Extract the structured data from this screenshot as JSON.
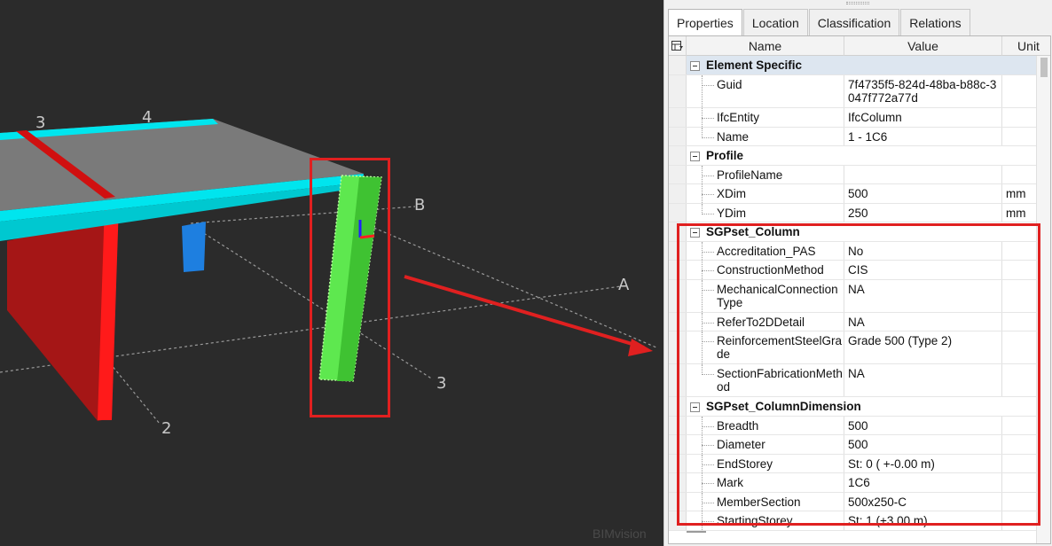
{
  "viewport": {
    "grid_labels": {
      "a": "A",
      "b": "B",
      "n2": "2",
      "n3_top": "3",
      "n3_bottom": "3",
      "n4": "4"
    },
    "watermark": "BIMvision"
  },
  "panel": {
    "tabs": [
      {
        "label": "Properties",
        "active": true
      },
      {
        "label": "Location",
        "active": false
      },
      {
        "label": "Classification",
        "active": false
      },
      {
        "label": "Relations",
        "active": false
      }
    ],
    "columns": {
      "name": "Name",
      "value": "Value",
      "unit": "Unit"
    },
    "groups": {
      "element_specific": "Element Specific",
      "profile": "Profile",
      "sgpset_column": "SGPset_Column",
      "sgpset_column_dimension": "SGPset_ColumnDimension"
    },
    "element_specific": [
      {
        "name": "Guid",
        "value": "7f4735f5-824d-48ba-b88c-3047f772a77d",
        "unit": ""
      },
      {
        "name": "IfcEntity",
        "value": "IfcColumn",
        "unit": ""
      },
      {
        "name": "Name",
        "value": "1 - 1C6",
        "unit": ""
      }
    ],
    "profile": [
      {
        "name": "ProfileName",
        "value": "",
        "unit": ""
      },
      {
        "name": "XDim",
        "value": "500",
        "unit": "mm"
      },
      {
        "name": "YDim",
        "value": "250",
        "unit": "mm"
      }
    ],
    "sgpset_column": [
      {
        "name": "Accreditation_PAS",
        "value": "No",
        "unit": ""
      },
      {
        "name": "ConstructionMethod",
        "value": "CIS",
        "unit": ""
      },
      {
        "name": "MechanicalConnectionType",
        "value": "NA",
        "unit": ""
      },
      {
        "name": "ReferTo2DDetail",
        "value": "NA",
        "unit": ""
      },
      {
        "name": "ReinforcementSteelGrade",
        "value": "Grade 500 (Type 2)",
        "unit": ""
      },
      {
        "name": "SectionFabricationMethod",
        "value": "NA",
        "unit": ""
      }
    ],
    "sgpset_column_dimension": [
      {
        "name": "Breadth",
        "value": "500",
        "unit": ""
      },
      {
        "name": "Diameter",
        "value": "500",
        "unit": ""
      },
      {
        "name": "EndStorey",
        "value": "St: 0 ( +-0.00 m)",
        "unit": ""
      },
      {
        "name": "Mark",
        "value": "1C6",
        "unit": ""
      },
      {
        "name": "MemberSection",
        "value": "500x250-C",
        "unit": ""
      },
      {
        "name": "StartingStorey",
        "value": "St: 1 (+3.00 m)",
        "unit": ""
      }
    ]
  },
  "colors": {
    "highlight": "#e02020",
    "slab_edge": "#00e5ee",
    "selected_column": "#5ee84f",
    "wall": "#cc1111",
    "blue_column": "#1e7fe0"
  }
}
